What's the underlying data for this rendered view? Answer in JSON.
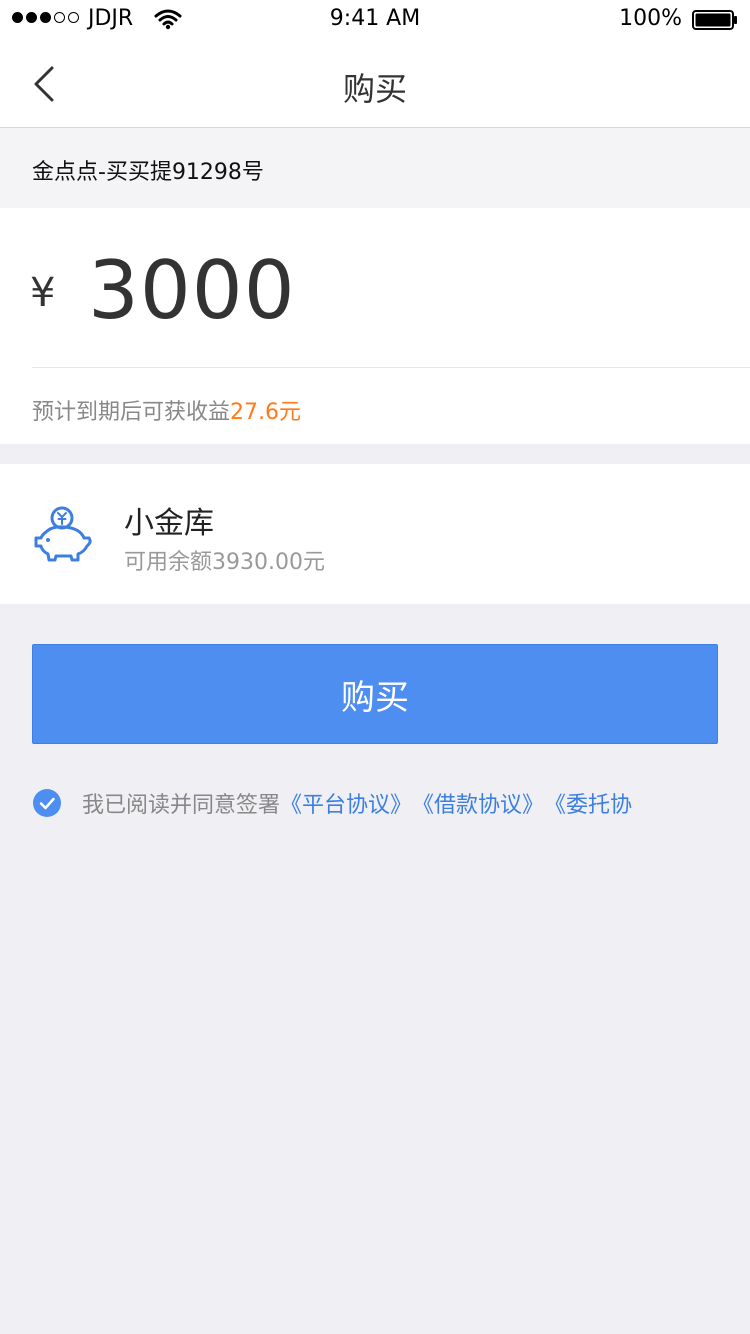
{
  "status_bar": {
    "carrier": "JDJR",
    "time": "9:41 AM",
    "battery": "100%"
  },
  "nav": {
    "title": "购买"
  },
  "product": {
    "name": "金点点-买买提91298号"
  },
  "amount": {
    "currency": "¥",
    "value": "3000",
    "income_prefix": "预计到期后可获收益",
    "income_value": "27.6元"
  },
  "account": {
    "name": "小金库",
    "balance": "可用余额3930.00元"
  },
  "buy_button": {
    "label": "购买"
  },
  "agreement": {
    "text": "我已阅读并同意签署",
    "links": [
      "《平台协议》",
      "《借款协议》",
      "《委托协"
    ]
  },
  "colors": {
    "accent": "#4d8ef0",
    "link": "#3d7fe0",
    "income": "#ff7a1a",
    "background": "#efeff4"
  }
}
